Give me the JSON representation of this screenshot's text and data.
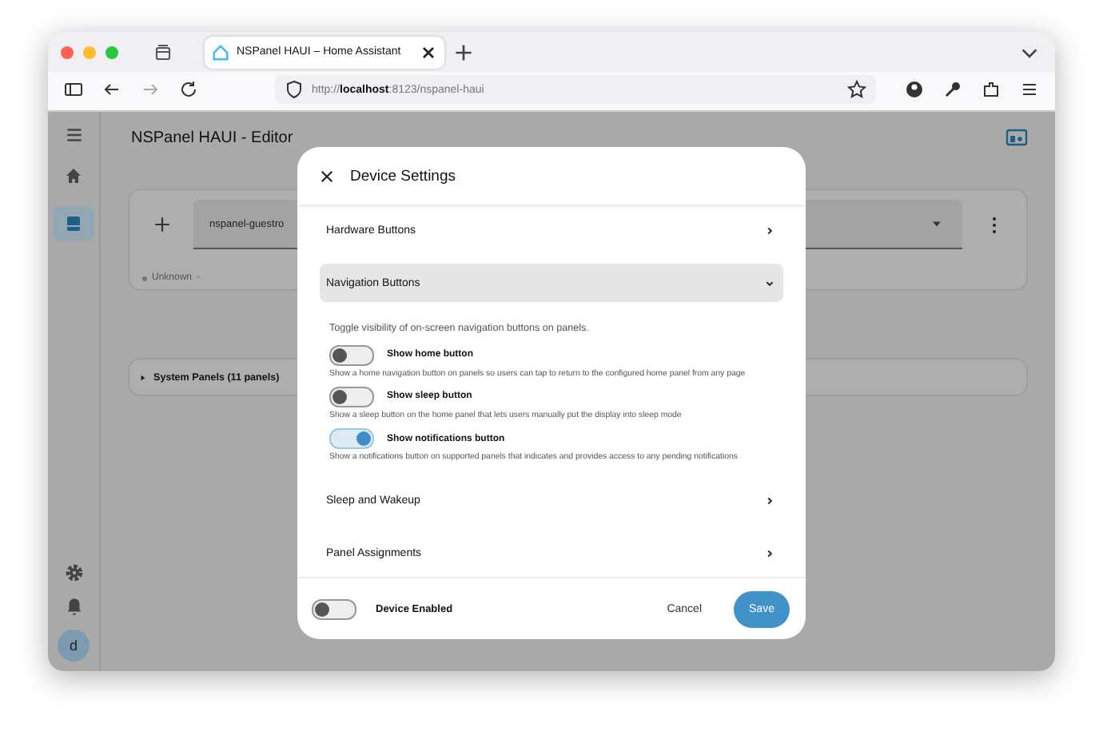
{
  "browser": {
    "tab_title": "NSPanel HAUI – Home Assistant",
    "url": "http://**localhost**:8123/nspanel-haui"
  },
  "app": {
    "title": "NSPanel HAUI - Editor",
    "sidebar_items": [
      {
        "kind": "home",
        "selected": false
      },
      {
        "kind": "panel",
        "selected": true
      }
    ],
    "avatar": "d",
    "device_card": {
      "select_value": "nspanel-guestro",
      "status": "Unknown",
      "status_extra": "-"
    },
    "system_panels": "System Panels (11 panels)"
  },
  "dialog": {
    "title": "Device Settings",
    "sections": [
      {
        "title": "Hardware Buttons",
        "expanded": false
      },
      {
        "title": "Navigation Buttons",
        "expanded": true,
        "description": "Toggle visibility of on-screen navigation buttons on panels.",
        "toggles": [
          {
            "label": "Show home button",
            "description": "Show a home navigation button on panels so users can tap to return to the configured home panel from any page",
            "on": false
          },
          {
            "label": "Show sleep button",
            "description": "Show a sleep button on the home panel that lets users manually put the display into sleep mode",
            "on": false
          },
          {
            "label": "Show notifications button",
            "description": "Show a notifications button on supported panels that indicates and provides access to any pending notifications",
            "on": true
          }
        ]
      },
      {
        "title": "Sleep and Wakeup",
        "expanded": false
      },
      {
        "title": "Panel Assignments",
        "expanded": false
      }
    ],
    "device_enabled": {
      "label": "Device Enabled",
      "on": false
    },
    "buttons": {
      "cancel": "Cancel",
      "save": "Save"
    }
  }
}
